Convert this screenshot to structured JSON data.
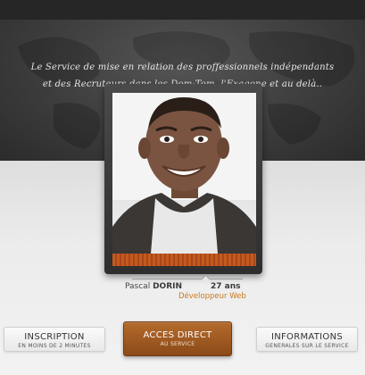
{
  "hero": {
    "tagline_line1": "Le Service de mise en relation des proffessionnels indépendants",
    "tagline_line2": "et des Recruteurs dans les Dom-Tom, l'Exagone et au delà.."
  },
  "profile": {
    "first_name": "Pascal",
    "last_name": "DORIN",
    "age": "27 ans",
    "job": "Développeur Web"
  },
  "buttons": {
    "inscription": {
      "title": "INSCRIPTION",
      "subtitle": "EN MOINS DE 2 MINUTES"
    },
    "acces": {
      "title": "ACCES DIRECT",
      "subtitle": "AU SERVICE"
    },
    "informations": {
      "title": "INFORMATIONS",
      "subtitle": "GENERALES SUR LE SERVICE"
    }
  },
  "colors": {
    "accent": "#c8781e",
    "primary_button": "#9c561f",
    "hero_background": "#3d3d3d"
  }
}
